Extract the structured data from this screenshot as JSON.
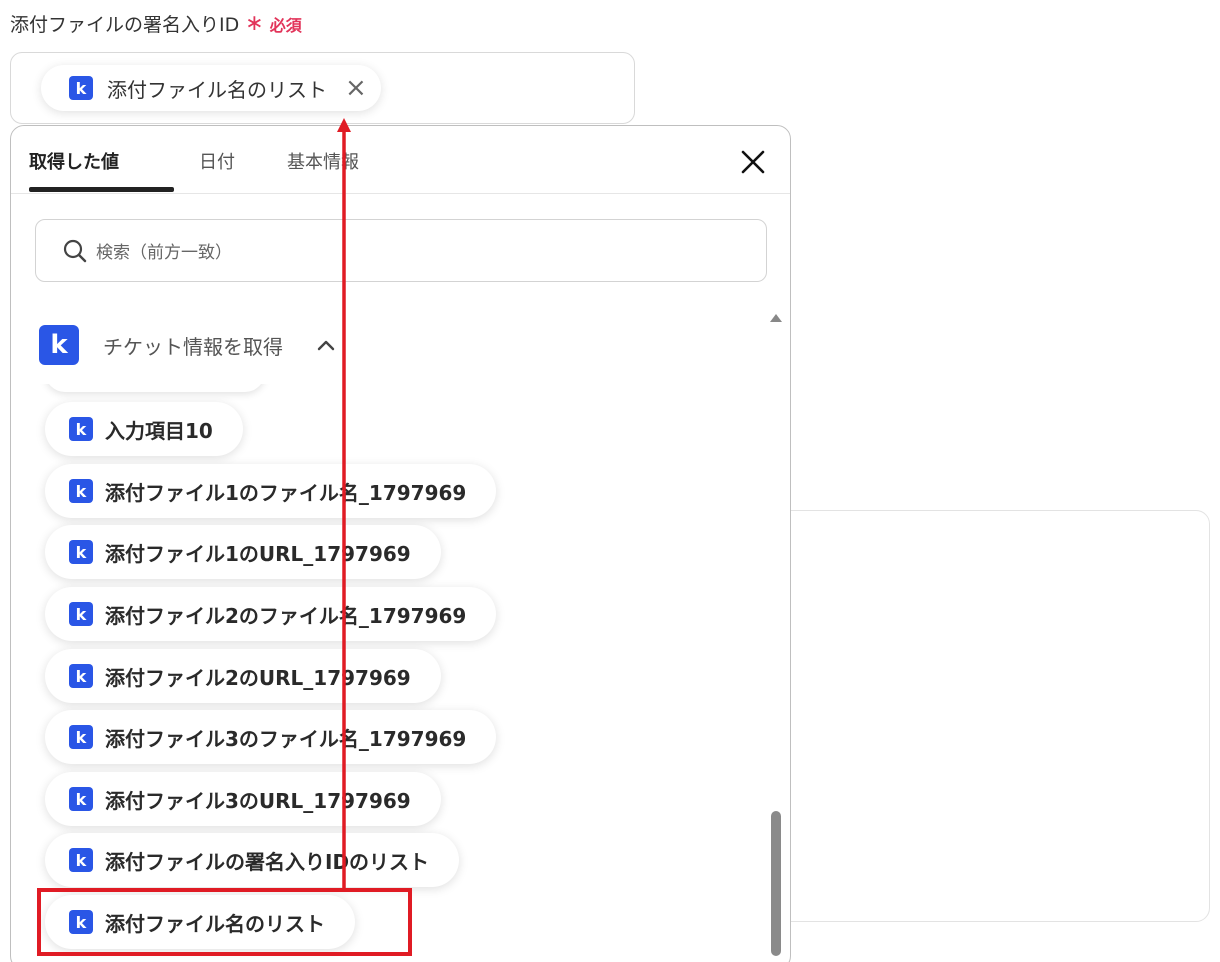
{
  "field": {
    "label": "添付ファイルの署名入りID",
    "required_mark": "∗",
    "required_text": "必須",
    "token_label": "添付ファイル名のリスト",
    "token_remove": "×"
  },
  "badge": {
    "letter": "k"
  },
  "popup": {
    "tabs": [
      {
        "label": "取得した値"
      },
      {
        "label": "日付"
      },
      {
        "label": "基本情報"
      }
    ],
    "search_placeholder": "検索（前方一致）",
    "section_title": "チケット情報を取得",
    "items": [
      {
        "label": "入力項目10"
      },
      {
        "label": "添付ファイル1のファイル名_1797969"
      },
      {
        "label": "添付ファイル1のURL_1797969"
      },
      {
        "label": "添付ファイル2のファイル名_1797969"
      },
      {
        "label": "添付ファイル2のURL_1797969"
      },
      {
        "label": "添付ファイル3のファイル名_1797969"
      },
      {
        "label": "添付ファイル3のURL_1797969"
      },
      {
        "label": "添付ファイルの署名入りIDのリスト"
      },
      {
        "label": "添付ファイル名のリスト"
      }
    ]
  },
  "colors": {
    "accent": "#2a56e6",
    "required": "#e2345a",
    "annotation": "#e01b24"
  }
}
